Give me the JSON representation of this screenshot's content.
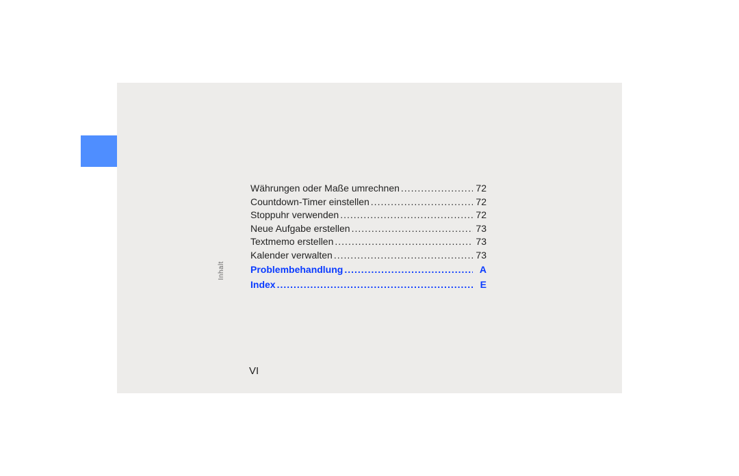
{
  "sideLabel": "Inhalt",
  "pageNumber": "VI",
  "toc": {
    "plain": [
      {
        "label": "Währungen oder Maße umrechnen",
        "page": "72"
      },
      {
        "label": "Countdown-Timer einstellen",
        "page": "72"
      },
      {
        "label": "Stoppuhr verwenden",
        "page": "72"
      },
      {
        "label": "Neue Aufgabe erstellen",
        "page": "73"
      },
      {
        "label": "Textmemo erstellen",
        "page": "73"
      },
      {
        "label": "Kalender verwalten",
        "page": "73"
      }
    ],
    "links": [
      {
        "label": "Problembehandlung",
        "page": "A"
      },
      {
        "label": "Index",
        "page": "E"
      }
    ]
  },
  "leaderDots": " .............................................................................................."
}
